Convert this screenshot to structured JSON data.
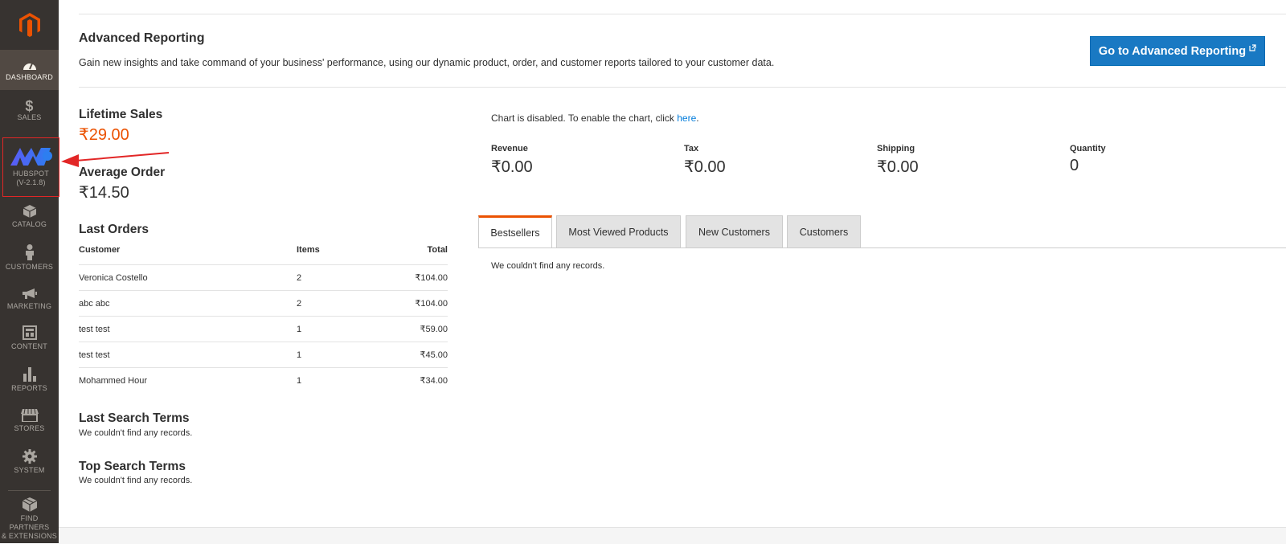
{
  "sidebar": {
    "items": [
      {
        "label": "DASHBOARD",
        "icon": "dashboard-icon"
      },
      {
        "label": "SALES",
        "icon": "dollar-icon"
      },
      {
        "label": "HUBSPOT",
        "sub": "(V-2.1.8)",
        "icon": "hubspot-logo-icon"
      },
      {
        "label": "CATALOG",
        "icon": "cube-icon"
      },
      {
        "label": "CUSTOMERS",
        "icon": "person-icon"
      },
      {
        "label": "MARKETING",
        "icon": "megaphone-icon"
      },
      {
        "label": "CONTENT",
        "icon": "layout-icon"
      },
      {
        "label": "REPORTS",
        "icon": "bar-chart-icon"
      },
      {
        "label": "STORES",
        "icon": "storefront-icon"
      },
      {
        "label": "SYSTEM",
        "icon": "gear-icon"
      },
      {
        "label": "FIND PARTNERS",
        "sub": "& EXTENSIONS",
        "icon": "boxes-icon"
      }
    ],
    "active": "DASHBOARD"
  },
  "advanced": {
    "title": "Advanced Reporting",
    "description": "Gain new insights and take command of your business' performance, using our dynamic product, order, and customer reports tailored to your customer data.",
    "button": "Go to Advanced Reporting"
  },
  "stats": {
    "lifetime_label": "Lifetime Sales",
    "lifetime_value": "₹29.00",
    "average_label": "Average Order",
    "average_value": "₹14.50"
  },
  "last_orders": {
    "title": "Last Orders",
    "columns": [
      "Customer",
      "Items",
      "Total"
    ],
    "rows": [
      [
        "Veronica Costello",
        "2",
        "₹104.00"
      ],
      [
        "abc abc",
        "2",
        "₹104.00"
      ],
      [
        "test test",
        "1",
        "₹59.00"
      ],
      [
        "test test",
        "1",
        "₹45.00"
      ],
      [
        "Mohammed Hour",
        "1",
        "₹34.00"
      ]
    ]
  },
  "search_terms": {
    "last_title": "Last Search Terms",
    "last_empty": "We couldn't find any records.",
    "top_title": "Top Search Terms",
    "top_empty": "We couldn't find any records."
  },
  "chart": {
    "message": "Chart is disabled. To enable the chart, click ",
    "link": "here",
    "suffix": "."
  },
  "totals": [
    {
      "label": "Revenue",
      "value": "₹0.00"
    },
    {
      "label": "Tax",
      "value": "₹0.00"
    },
    {
      "label": "Shipping",
      "value": "₹0.00"
    },
    {
      "label": "Quantity",
      "value": "0"
    }
  ],
  "tabs": {
    "items": [
      "Bestsellers",
      "Most Viewed Products",
      "New Customers",
      "Customers"
    ],
    "active": "Bestsellers",
    "empty": "We couldn't find any records."
  },
  "colors": {
    "accent": "#eb5202",
    "button": "#1979c3",
    "sidebar": "#373330",
    "link": "#007bdb"
  }
}
